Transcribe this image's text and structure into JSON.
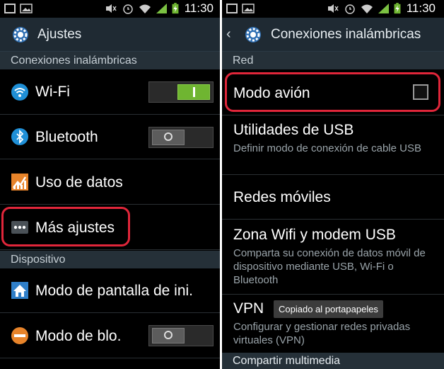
{
  "status": {
    "time": "11:30"
  },
  "colors": {
    "highlight": "#e0263a",
    "toggle_on": "#6fb531",
    "action_bar": "#1f2a33",
    "section_bar": "#253038"
  },
  "left": {
    "title": "Ajustes",
    "sections": {
      "wireless": "Conexiones inalámbricas",
      "device": "Dispositivo"
    },
    "items": [
      {
        "label": "Wi-Fi",
        "icon": "wifi-icon",
        "toggle": "on"
      },
      {
        "label": "Bluetooth",
        "icon": "bluetooth-icon",
        "toggle": "off"
      },
      {
        "label": "Uso de datos",
        "icon": "data-usage-icon"
      },
      {
        "label": "Más ajustes",
        "icon": "more-settings-icon"
      },
      {
        "label": "Modo de pantalla de ini.",
        "icon": "home-screen-icon"
      },
      {
        "label": "Modo de blo.",
        "icon": "block-mode-icon",
        "toggle": "off"
      }
    ]
  },
  "right": {
    "title": "Conexiones inalámbricas",
    "section_red": "Red",
    "items": [
      {
        "title": "Modo avión",
        "checked": false
      },
      {
        "title": "Utilidades de USB",
        "subtitle": "Definir modo de conexión de cable USB"
      },
      {
        "title": "Redes móviles"
      },
      {
        "title": "Zona Wifi y modem USB",
        "subtitle": "Comparta su conexión de datos móvil de dispositivo mediante USB, Wi-Fi o Bluetooth"
      },
      {
        "title": "VPN",
        "subtitle": "Configurar y gestionar redes privadas virtuales (VPN)"
      }
    ],
    "section_multimedia": "Compartir multimedia",
    "toast": "Copiado al portapapeles"
  }
}
